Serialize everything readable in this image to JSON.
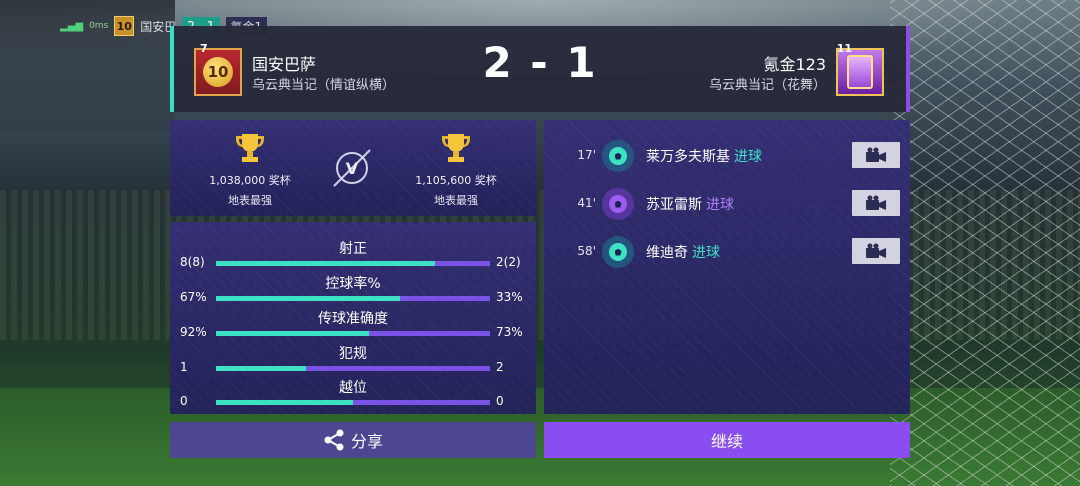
{
  "hud": {
    "ping": "0ms",
    "level": "10",
    "home_short": "国安巴",
    "score_short": "2 - 1",
    "away_short": "氪金1"
  },
  "match": {
    "home": {
      "rank": "7",
      "badge_level": "10",
      "name": "国安巴萨",
      "subtitle": "乌云典当记（情谊纵横）",
      "trophies": "1,038,000 奖杯",
      "title": "地表最强"
    },
    "away": {
      "rank": "11",
      "name": "氪金123",
      "subtitle": "乌云典当记（花舞）",
      "trophies": "1,105,600 奖杯",
      "title": "地表最强"
    },
    "score": "2 - 1"
  },
  "colors": {
    "home_accent": "#3fe1c4",
    "away_accent": "#8a4ef0"
  },
  "stats": [
    {
      "label": "射正",
      "home": "8(8)",
      "away": "2(2)",
      "home_share": 0.8
    },
    {
      "label": "控球率%",
      "home": "67%",
      "away": "33%",
      "home_share": 0.67
    },
    {
      "label": "传球准确度",
      "home": "92%",
      "away": "73%",
      "home_share": 0.56
    },
    {
      "label": "犯规",
      "home": "1",
      "away": "2",
      "home_share": 0.33
    },
    {
      "label": "越位",
      "home": "0",
      "away": "0",
      "home_share": 0.5
    }
  ],
  "events": [
    {
      "minute": "17'",
      "player": "莱万多夫斯基",
      "type": "进球",
      "side": "home",
      "icon": "goal-ball-icon"
    },
    {
      "minute": "41'",
      "player": "苏亚雷斯",
      "type": "进球",
      "side": "away",
      "icon": "goal-ball-icon"
    },
    {
      "minute": "58'",
      "player": "维迪奇",
      "type": "进球",
      "side": "home",
      "icon": "goal-ball-icon"
    }
  ],
  "buttons": {
    "share": "分享",
    "continue": "继续"
  },
  "vs_label": "V"
}
